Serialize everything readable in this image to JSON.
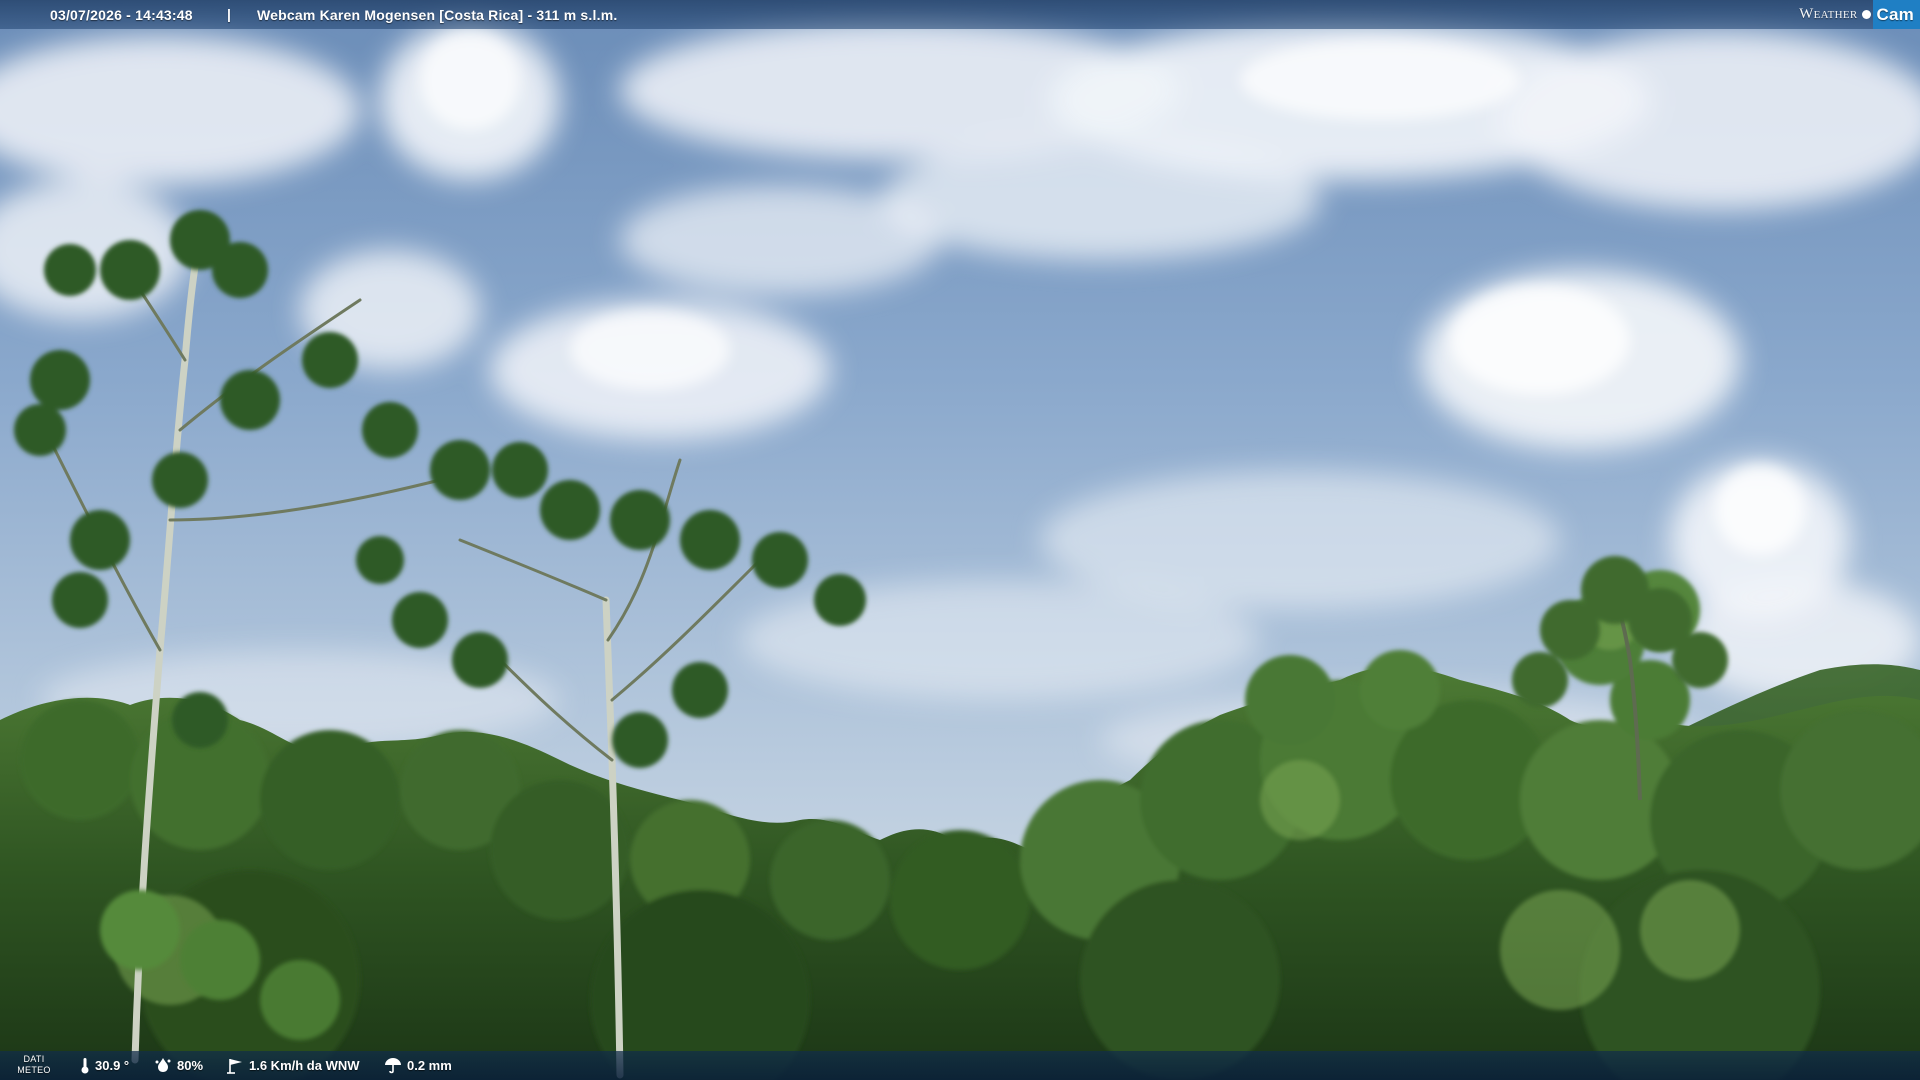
{
  "overlay": {
    "datetime": "03/07/2026 - 14:43:48",
    "separator": "|",
    "location": "Webcam Karen Mogensen [Costa Rica]  - 311 m s.l.m.",
    "brand": {
      "weather": "Weather",
      "cam": "Cam"
    }
  },
  "meteo": {
    "label_line1": "DATI",
    "label_line2": "METEO",
    "temperature": "30.9 °",
    "humidity": "80%",
    "wind": "1.6 Km/h da WNW",
    "rain": "0.2 mm"
  },
  "icons": {
    "temperature": "thermometer-icon",
    "humidity": "humidity-drop-icon",
    "wind": "wind-vane-icon",
    "rain": "rain-umbrella-icon",
    "brand_dot": "weather-dot-icon"
  },
  "colors": {
    "sky_top": "#6d90bb",
    "sky_mid": "#9ab4d1",
    "sky_horizon": "#c7d6e4",
    "cloud": "#f2f5f9",
    "forest_dark": "#1f3a18",
    "forest_mid": "#3f6a2a",
    "forest_light": "#6f9b4a",
    "brand_blue": "#1f7fc4"
  }
}
